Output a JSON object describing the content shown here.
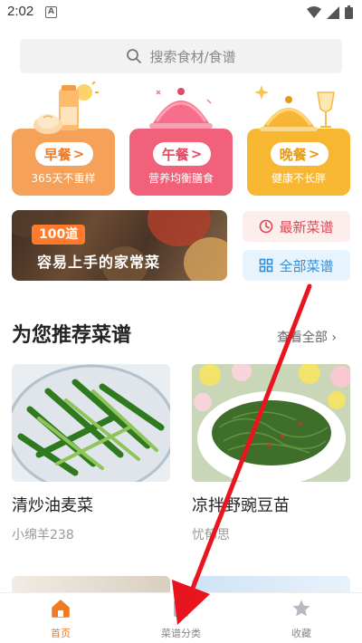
{
  "status_bar": {
    "time": "2:02",
    "notif": "A"
  },
  "search": {
    "placeholder": "搜索食材/食谱"
  },
  "meals": [
    {
      "label": "早餐",
      "sub": "365天不重样"
    },
    {
      "label": "午餐",
      "sub": "营养均衡膳食"
    },
    {
      "label": "晚餐",
      "sub": "健康不长胖"
    }
  ],
  "banner": {
    "badge": "100道",
    "title": "容易上手的家常菜"
  },
  "quick": {
    "latest": "最新菜谱",
    "all": "全部菜谱"
  },
  "section": {
    "title": "为您推荐菜谱",
    "more": "查看全部"
  },
  "recipes": [
    {
      "name": "清炒油麦菜",
      "author": "小绵羊238"
    },
    {
      "name": "凉拌野豌豆苗",
      "author": "忧郁思"
    }
  ],
  "tabbar": {
    "home": "首页",
    "category": "菜谱分类",
    "favorites": "收藏"
  },
  "colors": {
    "accent": "#f07a22",
    "arrow": "#e8141e"
  }
}
